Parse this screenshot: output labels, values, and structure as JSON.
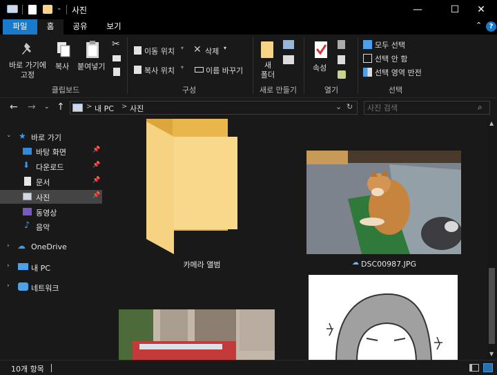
{
  "window": {
    "title": "사진",
    "minimize_glyph": "—",
    "maximize_glyph": "☐",
    "close_glyph": "✕"
  },
  "ribbon_tabs": [
    {
      "label": "파일"
    },
    {
      "label": "홈"
    },
    {
      "label": "공유"
    },
    {
      "label": "보기"
    }
  ],
  "ribbon": {
    "clipboard": {
      "pin_label": "바로 가기에\n고정",
      "copy_label": "복사",
      "paste_label": "붙여넣기",
      "group_label": "클립보드"
    },
    "organize": {
      "move_to": "이동 위치",
      "copy_to": "복사 위치",
      "delete": "삭제",
      "rename": "이름 바꾸기",
      "group_label": "구성"
    },
    "new": {
      "new_folder": "새\n폴더",
      "group_label": "새로 만들기"
    },
    "open": {
      "properties": "속성",
      "group_label": "열기"
    },
    "select": {
      "select_all": "모두 선택",
      "select_none": "선택 안 함",
      "invert": "선택 영역 반전",
      "group_label": "선택"
    }
  },
  "address": {
    "segments": [
      "내 PC",
      "사진"
    ],
    "separator": ">"
  },
  "search": {
    "placeholder": "사진 검색"
  },
  "sidebar": {
    "quick_access": "바로 가기",
    "items": [
      {
        "label": "바탕 화면",
        "pinned": true
      },
      {
        "label": "다운로드",
        "pinned": true
      },
      {
        "label": "문서",
        "pinned": true
      },
      {
        "label": "사진",
        "pinned": true,
        "selected": true
      },
      {
        "label": "동영상"
      },
      {
        "label": "음악"
      }
    ],
    "onedrive": "OneDrive",
    "this_pc": "내 PC",
    "network": "네트워크"
  },
  "content": {
    "items": [
      {
        "label": "카메라 앨범",
        "type": "folder"
      },
      {
        "label": "DSC00987.JPG",
        "type": "image",
        "cloud": true
      },
      {
        "label": "",
        "type": "image"
      },
      {
        "label": "",
        "type": "image"
      }
    ]
  },
  "status": {
    "item_count": "10개 항목"
  },
  "colors": {
    "accent": "#1979ca",
    "folder": "#f7d386",
    "background": "#191919"
  }
}
